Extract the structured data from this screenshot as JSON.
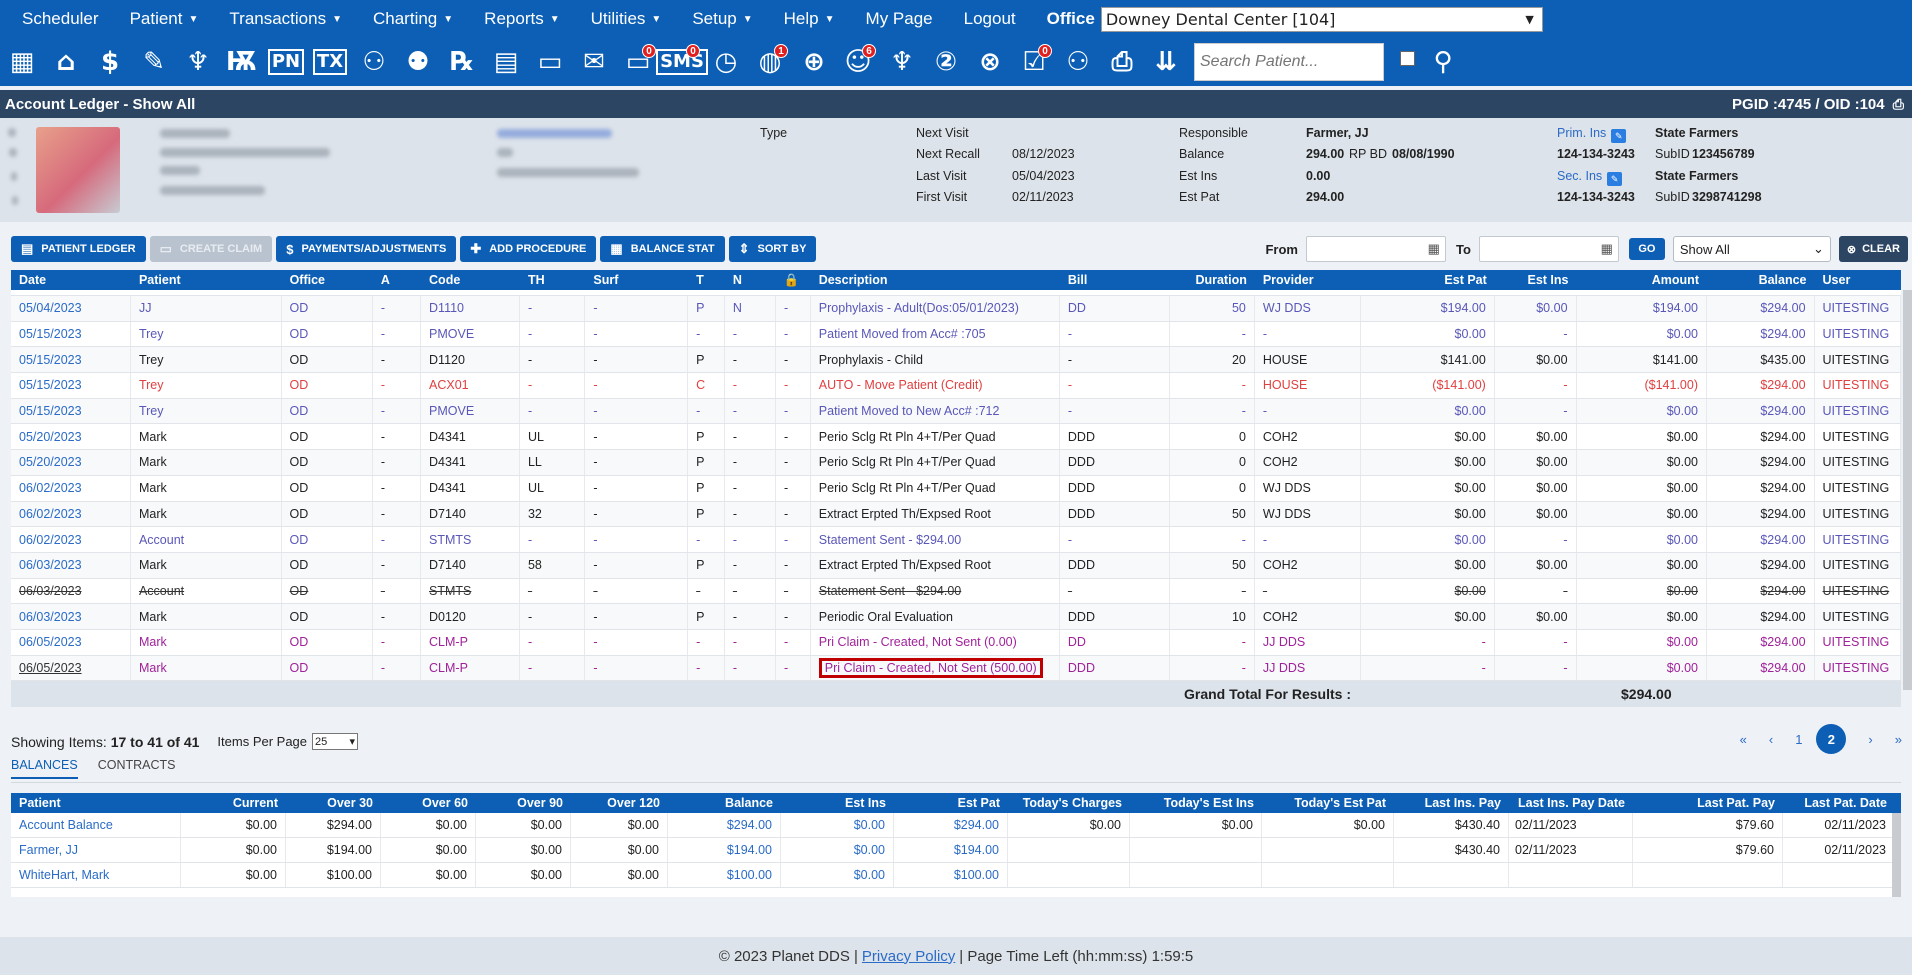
{
  "nav": {
    "items": [
      "Scheduler",
      "Patient",
      "Transactions",
      "Charting",
      "Reports",
      "Utilities",
      "Setup",
      "Help",
      "My Page",
      "Logout"
    ],
    "dropdown_flags": [
      false,
      true,
      true,
      true,
      true,
      true,
      true,
      true,
      false,
      false
    ],
    "office_label": "Office",
    "office_value": "Downey Dental Center [104]"
  },
  "toolbar": {
    "icons": [
      {
        "name": "calendar-icon",
        "glyph": "▦"
      },
      {
        "name": "home-icon",
        "glyph": "⌂"
      },
      {
        "name": "dollar-gear-icon",
        "glyph": "$"
      },
      {
        "name": "edit-chart-icon",
        "glyph": "✎"
      },
      {
        "name": "tooth-icon",
        "glyph": "♆"
      },
      {
        "name": "perio-tooth-icon",
        "glyph": "Ѭ"
      },
      {
        "name": "pn-icon",
        "text": "PN"
      },
      {
        "name": "tx-icon",
        "text": "TX"
      },
      {
        "name": "add-patient-icon",
        "glyph": "⚇"
      },
      {
        "name": "add-family-icon",
        "glyph": "⚉"
      },
      {
        "name": "rx-icon",
        "glyph": "℞"
      },
      {
        "name": "notes-icon",
        "glyph": "▤"
      },
      {
        "name": "document-icon",
        "glyph": "▭"
      },
      {
        "name": "mail-icon",
        "glyph": "✉"
      },
      {
        "name": "chat-icon",
        "glyph": "▭",
        "badge": "0"
      },
      {
        "name": "sms-icon",
        "text": "SMS",
        "badge": "0"
      },
      {
        "name": "clock-icon",
        "glyph": "◷"
      },
      {
        "name": "globe-alert-icon",
        "glyph": "◍",
        "badge": "1"
      },
      {
        "name": "world-icon",
        "glyph": "⊕"
      },
      {
        "name": "smile-alert-icon",
        "glyph": "☺",
        "badge": "6"
      },
      {
        "name": "tooth-outline-icon",
        "glyph": "♆"
      },
      {
        "name": "tooth-two-icon",
        "glyph": "②"
      },
      {
        "name": "web-icon",
        "glyph": "⊗"
      },
      {
        "name": "claim-check-icon",
        "glyph": "☑",
        "badge": "0"
      },
      {
        "name": "group-icon",
        "glyph": "⚇"
      },
      {
        "name": "printer-icon",
        "glyph": "⎙"
      },
      {
        "name": "chevron-stack-icon",
        "glyph": "⇊"
      }
    ],
    "search_placeholder": "Search Patient..."
  },
  "page": {
    "title": "Account Ledger - Show All",
    "ids": "PGID :4745  /  OID :104"
  },
  "patient": {
    "type_label": "Type",
    "next_visit_label": "Next Visit",
    "next_visit": "",
    "next_recall_label": "Next Recall",
    "next_recall": "08/12/2023",
    "last_visit_label": "Last Visit",
    "last_visit": "05/04/2023",
    "first_visit_label": "First Visit",
    "first_visit": "02/11/2023",
    "responsible_label": "Responsible",
    "responsible": "Farmer, JJ",
    "balance_label": "Balance",
    "balance": "294.00",
    "rpbd_label": "RP BD",
    "rpbd": "08/08/1990",
    "est_ins_label": "Est Ins",
    "est_ins": "0.00",
    "est_pat_label": "Est Pat",
    "est_pat": "294.00",
    "prim_ins_label": "Prim. Ins",
    "prim_ins": "State Farmers",
    "prim_phone": "124-134-3243",
    "prim_subid_label": "SubID",
    "prim_subid": "123456789",
    "sec_ins_label": "Sec. Ins",
    "sec_ins": "State Farmers",
    "sec_phone": "124-134-3243",
    "sec_subid_label": "SubID",
    "sec_subid": "3298741298"
  },
  "actions": {
    "buttons": [
      {
        "name": "patient-ledger-button",
        "icon": "▤",
        "label": "PATIENT LEDGER",
        "disabled": false
      },
      {
        "name": "create-claim-button",
        "icon": "▭",
        "label": "CREATE CLAIM",
        "disabled": true
      },
      {
        "name": "payments-adjustments-button",
        "icon": "$",
        "label": "PAYMENTS/ADJUSTMENTS",
        "disabled": false
      },
      {
        "name": "add-procedure-button",
        "icon": "✚",
        "label": "ADD PROCEDURE",
        "disabled": false
      },
      {
        "name": "balance-stat-button",
        "icon": "▦",
        "label": "BALANCE STAT",
        "disabled": false
      },
      {
        "name": "sort-by-button",
        "icon": "⇕",
        "label": "SORT BY",
        "disabled": false
      }
    ],
    "from_label": "From",
    "to_label": "To",
    "go_label": "GO",
    "show_value": "Show All",
    "clear_label": "CLEAR"
  },
  "ledger": {
    "columns": [
      "Date",
      "Patient",
      "Office",
      "A",
      "Code",
      "TH",
      "Surf",
      "T",
      "N",
      "🔒",
      "Description",
      "Bill",
      "Duration",
      "Provider",
      "Est Pat",
      "Est Ins",
      "Amount",
      "Balance",
      "User"
    ],
    "rows": [
      {
        "style": "blue",
        "cells": [
          "05/04/2023",
          "JJ",
          "OD",
          "-",
          "D1110",
          "-",
          "-",
          "P",
          "N",
          "-",
          "Prophylaxis - Adult(Dos:05/01/2023)",
          "DD",
          "50",
          "WJ DDS",
          "$194.00",
          "$0.00",
          "$194.00",
          "$294.00",
          "UITESTING"
        ]
      },
      {
        "style": "blue",
        "cells": [
          "05/15/2023",
          "Trey",
          "OD",
          "-",
          "PMOVE",
          "-",
          "-",
          "-",
          "-",
          "-",
          "Patient Moved from Acc# :705",
          "-",
          "-",
          "-",
          "$0.00",
          "-",
          "$0.00",
          "$294.00",
          "UITESTING"
        ]
      },
      {
        "style": "normal",
        "cells": [
          "05/15/2023",
          "Trey",
          "OD",
          "-",
          "D1120",
          "-",
          "-",
          "P",
          "-",
          "-",
          "Prophylaxis - Child",
          "-",
          "20",
          "HOUSE",
          "$141.00",
          "$0.00",
          "$141.00",
          "$435.00",
          "UITESTING"
        ]
      },
      {
        "style": "red",
        "cells": [
          "05/15/2023",
          "Trey",
          "OD",
          "-",
          "ACX01",
          "-",
          "-",
          "C",
          "-",
          "-",
          "AUTO - Move Patient (Credit)",
          "-",
          "-",
          "HOUSE",
          "($141.00)",
          "-",
          "($141.00)",
          "$294.00",
          "UITESTING"
        ]
      },
      {
        "style": "blue",
        "cells": [
          "05/15/2023",
          "Trey",
          "OD",
          "-",
          "PMOVE",
          "-",
          "-",
          "-",
          "-",
          "-",
          "Patient Moved to New Acc# :712",
          "-",
          "-",
          "-",
          "$0.00",
          "-",
          "$0.00",
          "$294.00",
          "UITESTING"
        ]
      },
      {
        "style": "normal",
        "cells": [
          "05/20/2023",
          "Mark",
          "OD",
          "-",
          "D4341",
          "UL",
          "-",
          "P",
          "-",
          "-",
          "Perio Sclg Rt Pln 4+T/Per Quad",
          "DDD",
          "0",
          "COH2",
          "$0.00",
          "$0.00",
          "$0.00",
          "$294.00",
          "UITESTING"
        ]
      },
      {
        "style": "normal",
        "cells": [
          "05/20/2023",
          "Mark",
          "OD",
          "-",
          "D4341",
          "LL",
          "-",
          "P",
          "-",
          "-",
          "Perio Sclg Rt Pln 4+T/Per Quad",
          "DDD",
          "0",
          "COH2",
          "$0.00",
          "$0.00",
          "$0.00",
          "$294.00",
          "UITESTING"
        ]
      },
      {
        "style": "normal",
        "cells": [
          "06/02/2023",
          "Mark",
          "OD",
          "-",
          "D4341",
          "UL",
          "-",
          "P",
          "-",
          "-",
          "Perio Sclg Rt Pln 4+T/Per Quad",
          "DDD",
          "0",
          "WJ DDS",
          "$0.00",
          "$0.00",
          "$0.00",
          "$294.00",
          "UITESTING"
        ]
      },
      {
        "style": "normal",
        "cells": [
          "06/02/2023",
          "Mark",
          "OD",
          "-",
          "D7140",
          "32",
          "-",
          "P",
          "-",
          "-",
          "Extract Erpted Th/Expsed Root",
          "DDD",
          "50",
          "WJ DDS",
          "$0.00",
          "$0.00",
          "$0.00",
          "$294.00",
          "UITESTING"
        ]
      },
      {
        "style": "blue",
        "cells": [
          "06/02/2023",
          "Account",
          "OD",
          "-",
          "STMTS",
          "-",
          "-",
          "-",
          "-",
          "-",
          "Statement Sent - $294.00",
          "-",
          "-",
          "-",
          "$0.00",
          "-",
          "$0.00",
          "$294.00",
          "UITESTING"
        ]
      },
      {
        "style": "normal",
        "cells": [
          "06/03/2023",
          "Mark",
          "OD",
          "-",
          "D7140",
          "58",
          "-",
          "P",
          "-",
          "-",
          "Extract Erpted Th/Expsed Root",
          "DDD",
          "50",
          "COH2",
          "$0.00",
          "$0.00",
          "$0.00",
          "$294.00",
          "UITESTING"
        ]
      },
      {
        "style": "strike",
        "cells": [
          "06/03/2023",
          "Account",
          "OD",
          "-",
          "STMTS",
          "-",
          "-",
          "-",
          "-",
          "-",
          "Statement Sent - $294.00",
          "-",
          "-",
          "-",
          "$0.00",
          "-",
          "$0.00",
          "$294.00",
          "UITESTING"
        ]
      },
      {
        "style": "normal",
        "cells": [
          "06/03/2023",
          "Mark",
          "OD",
          "-",
          "D0120",
          "-",
          "-",
          "P",
          "-",
          "-",
          "Periodic Oral Evaluation",
          "DDD",
          "10",
          "COH2",
          "$0.00",
          "$0.00",
          "$0.00",
          "$294.00",
          "UITESTING"
        ]
      },
      {
        "style": "purple",
        "cells": [
          "06/05/2023",
          "Mark",
          "OD",
          "-",
          "CLM-P",
          "-",
          "-",
          "-",
          "-",
          "-",
          "Pri Claim - Created, Not Sent (0.00)",
          "DD",
          "-",
          "JJ DDS",
          "-",
          "-",
          "$0.00",
          "$294.00",
          "UITESTING"
        ]
      },
      {
        "style": "purple-sel",
        "cells": [
          "06/05/2023",
          "Mark",
          "OD",
          "-",
          "CLM-P",
          "-",
          "-",
          "-",
          "-",
          "-",
          "Pri Claim - Created, Not Sent (500.00)",
          "DDD",
          "-",
          "JJ DDS",
          "-",
          "-",
          "$0.00",
          "$294.00",
          "UITESTING"
        ]
      }
    ],
    "grand_total_label": "Grand Total For Results :",
    "grand_total": "$294.00"
  },
  "pagination": {
    "showing_label": "Showing Items:",
    "showing_value": "17 to 41 of 41",
    "per_page_label": "Items Per Page",
    "per_page_value": "25",
    "first": "«",
    "prev": "‹",
    "pages": [
      "1",
      "2"
    ],
    "current": "2",
    "next": "›",
    "last": "»"
  },
  "tabs": [
    "BALANCES",
    "CONTRACTS"
  ],
  "balances": {
    "columns": [
      "Patient",
      "Current",
      "Over 30",
      "Over 60",
      "Over 90",
      "Over 120",
      "Balance",
      "Est Ins",
      "Est Pat",
      "Today's Charges",
      "Today's Est Ins",
      "Today's Est Pat",
      "Last Ins. Pay",
      "Last Ins. Pay Date",
      "Last Pat. Pay",
      "Last Pat. Date"
    ],
    "rows": [
      [
        "Account Balance",
        "$0.00",
        "$294.00",
        "$0.00",
        "$0.00",
        "$0.00",
        "$294.00",
        "$0.00",
        "$294.00",
        "$0.00",
        "$0.00",
        "$0.00",
        "$430.40",
        "02/11/2023",
        "$79.60",
        "02/11/2023"
      ],
      [
        "Farmer, JJ",
        "$0.00",
        "$194.00",
        "$0.00",
        "$0.00",
        "$0.00",
        "$194.00",
        "$0.00",
        "$194.00",
        "",
        "",
        "",
        "$430.40",
        "02/11/2023",
        "$79.60",
        "02/11/2023"
      ],
      [
        "WhiteHart, Mark",
        "$0.00",
        "$100.00",
        "$0.00",
        "$0.00",
        "$0.00",
        "$100.00",
        "$0.00",
        "$100.00",
        "",
        "",
        "",
        "",
        "",
        "",
        ""
      ]
    ]
  },
  "footer": {
    "copyright": "© 2023 Planet DDS |",
    "privacy": "Privacy Policy",
    "time_left": "|  Page Time Left (hh:mm:ss) 1:59:5"
  }
}
